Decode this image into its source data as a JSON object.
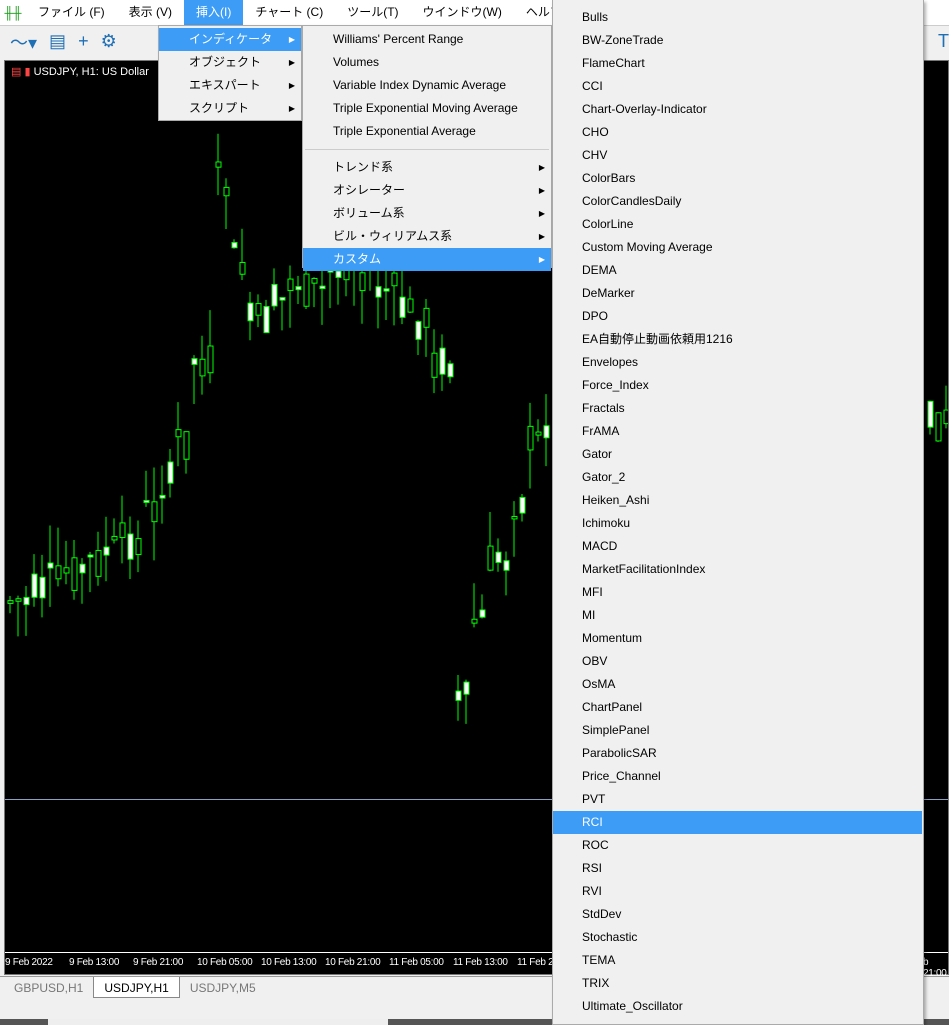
{
  "menubar": {
    "items": [
      "ファイル (F)",
      "表示 (V)",
      "挿入(I)",
      "チャート (C)",
      "ツール(T)",
      "ウインドウ(W)",
      "ヘルプ(H)"
    ],
    "active": "挿入(I)"
  },
  "chart": {
    "title": "USDJPY, H1:  US Dollar",
    "candle_color": "#00ff00",
    "time_labels": [
      "9 Feb 2022",
      "9 Feb 13:00",
      "9 Feb 21:00",
      "10 Feb 05:00",
      "10 Feb 13:00",
      "10 Feb 21:00",
      "11 Feb 05:00",
      "11 Feb 13:00",
      "11 Feb 2",
      "b 21:00"
    ]
  },
  "tabs": [
    "GBPUSD,H1",
    "USDJPY,H1",
    "USDJPY,M5"
  ],
  "menu_insert": {
    "items": [
      "インディケータ",
      "オブジェクト",
      "エキスパート",
      "スクリプト"
    ]
  },
  "menu_indicators": {
    "top": [
      "Williams' Percent Range",
      "Volumes",
      "Variable Index Dynamic Average",
      "Triple Exponential Moving Average",
      "Triple Exponential Average"
    ],
    "groups": [
      "トレンド系",
      "オシレーター",
      "ボリューム系",
      "ビル・ウィリアムス系",
      "カスタム"
    ]
  },
  "menu_custom": {
    "items": [
      "Bulls",
      "BW-ZoneTrade",
      "FlameChart",
      "CCI",
      "Chart-Overlay-Indicator",
      "CHO",
      "CHV",
      "ColorBars",
      "ColorCandlesDaily",
      "ColorLine",
      "Custom Moving Average",
      "DEMA",
      "DeMarker",
      "DPO",
      "EA自動停止動画依頼用1216",
      "Envelopes",
      "Force_Index",
      "Fractals",
      "FrAMA",
      "Gator",
      "Gator_2",
      "Heiken_Ashi",
      "Ichimoku",
      "MACD",
      "MarketFacilitationIndex",
      "MFI",
      "MI",
      "Momentum",
      "OBV",
      "OsMA",
      "ChartPanel",
      "SimplePanel",
      "ParabolicSAR",
      "Price_Channel",
      "PVT",
      "RCI",
      "ROC",
      "RSI",
      "RVI",
      "StdDev",
      "Stochastic",
      "TEMA",
      "TRIX",
      "Ultimate_Oscillator"
    ],
    "selected": "RCI"
  },
  "accent": "#3d9cf5"
}
